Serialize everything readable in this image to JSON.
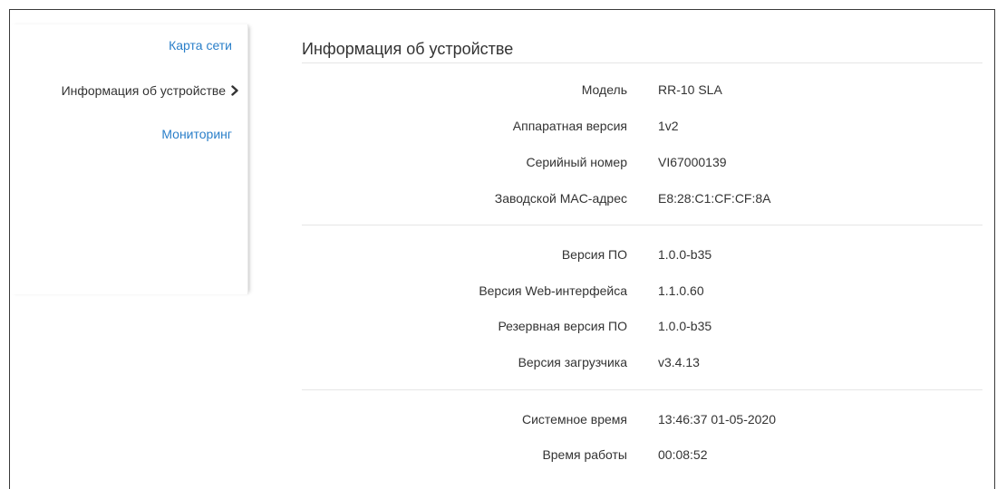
{
  "sidebar": {
    "items": [
      {
        "label": "Карта сети",
        "state": "link"
      },
      {
        "label": "Информация об устройстве",
        "state": "active",
        "icon": "chevron-right-icon"
      },
      {
        "label": "Мониторинг",
        "state": "link"
      }
    ]
  },
  "main": {
    "title": "Информация об устройстве",
    "groups": [
      {
        "rows": [
          {
            "label": "Модель",
            "value": "RR-10 SLA"
          },
          {
            "label": "Аппаратная версия",
            "value": "1v2"
          },
          {
            "label": "Серийный номер",
            "value": "VI67000139"
          },
          {
            "label": "Заводской MAC-адрес",
            "value": "E8:28:C1:CF:CF:8A"
          }
        ]
      },
      {
        "rows": [
          {
            "label": "Версия ПО",
            "value": "1.0.0-b35"
          },
          {
            "label": "Версия Web-интерфейса",
            "value": "1.1.0.60"
          },
          {
            "label": "Резервная версия ПО",
            "value": "1.0.0-b35"
          },
          {
            "label": "Версия загрузчика",
            "value": "v3.4.13"
          }
        ]
      },
      {
        "rows": [
          {
            "label": "Системное время",
            "value": "13:46:37 01-05-2020"
          },
          {
            "label": "Время работы",
            "value": "00:08:52"
          }
        ]
      }
    ]
  },
  "colors": {
    "link": "#2a7fc9",
    "text": "#333333",
    "divider": "#e6e6e6"
  }
}
